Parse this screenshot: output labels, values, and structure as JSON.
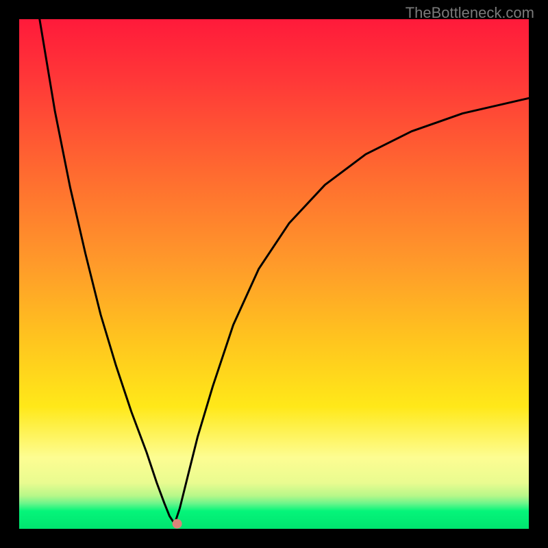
{
  "watermark": "TheBottleneck.com",
  "chart_data": {
    "type": "line",
    "title": "",
    "xlabel": "",
    "ylabel": "",
    "xlim": [
      0,
      100
    ],
    "ylim": [
      0,
      100
    ],
    "grid": false,
    "legend": false,
    "background": "heat-gradient (red→orange→yellow→green, green at bottom)",
    "series": [
      {
        "name": "left-branch",
        "x": [
          4,
          7,
          10,
          13,
          16,
          19,
          22,
          25,
          27,
          28.5,
          29.5,
          30.5
        ],
        "y": [
          100,
          82,
          67,
          54,
          42,
          32,
          23,
          15,
          9,
          5,
          2.5,
          1
        ]
      },
      {
        "name": "right-branch",
        "x": [
          30.5,
          31.5,
          33,
          35,
          38,
          42,
          47,
          53,
          60,
          68,
          77,
          87,
          100
        ],
        "y": [
          1,
          4,
          10,
          18,
          28,
          40,
          51,
          60,
          67.5,
          73.5,
          78,
          81.5,
          84.5
        ]
      }
    ],
    "marker": {
      "x": 31,
      "y": 1,
      "color": "#d9847a",
      "r": 7
    },
    "bottom_bands": [
      {
        "from": 0,
        "to": 3.5,
        "color": "#05f57a"
      },
      {
        "from": 3.5,
        "to": 5.0,
        "color": "#6df58b"
      },
      {
        "from": 5.0,
        "to": 6.5,
        "color": "#b7f789"
      },
      {
        "from": 6.5,
        "to": 9.0,
        "color": "#e9fb90"
      },
      {
        "from": 9.0,
        "to": 14,
        "color": "#fdfd92"
      }
    ]
  }
}
